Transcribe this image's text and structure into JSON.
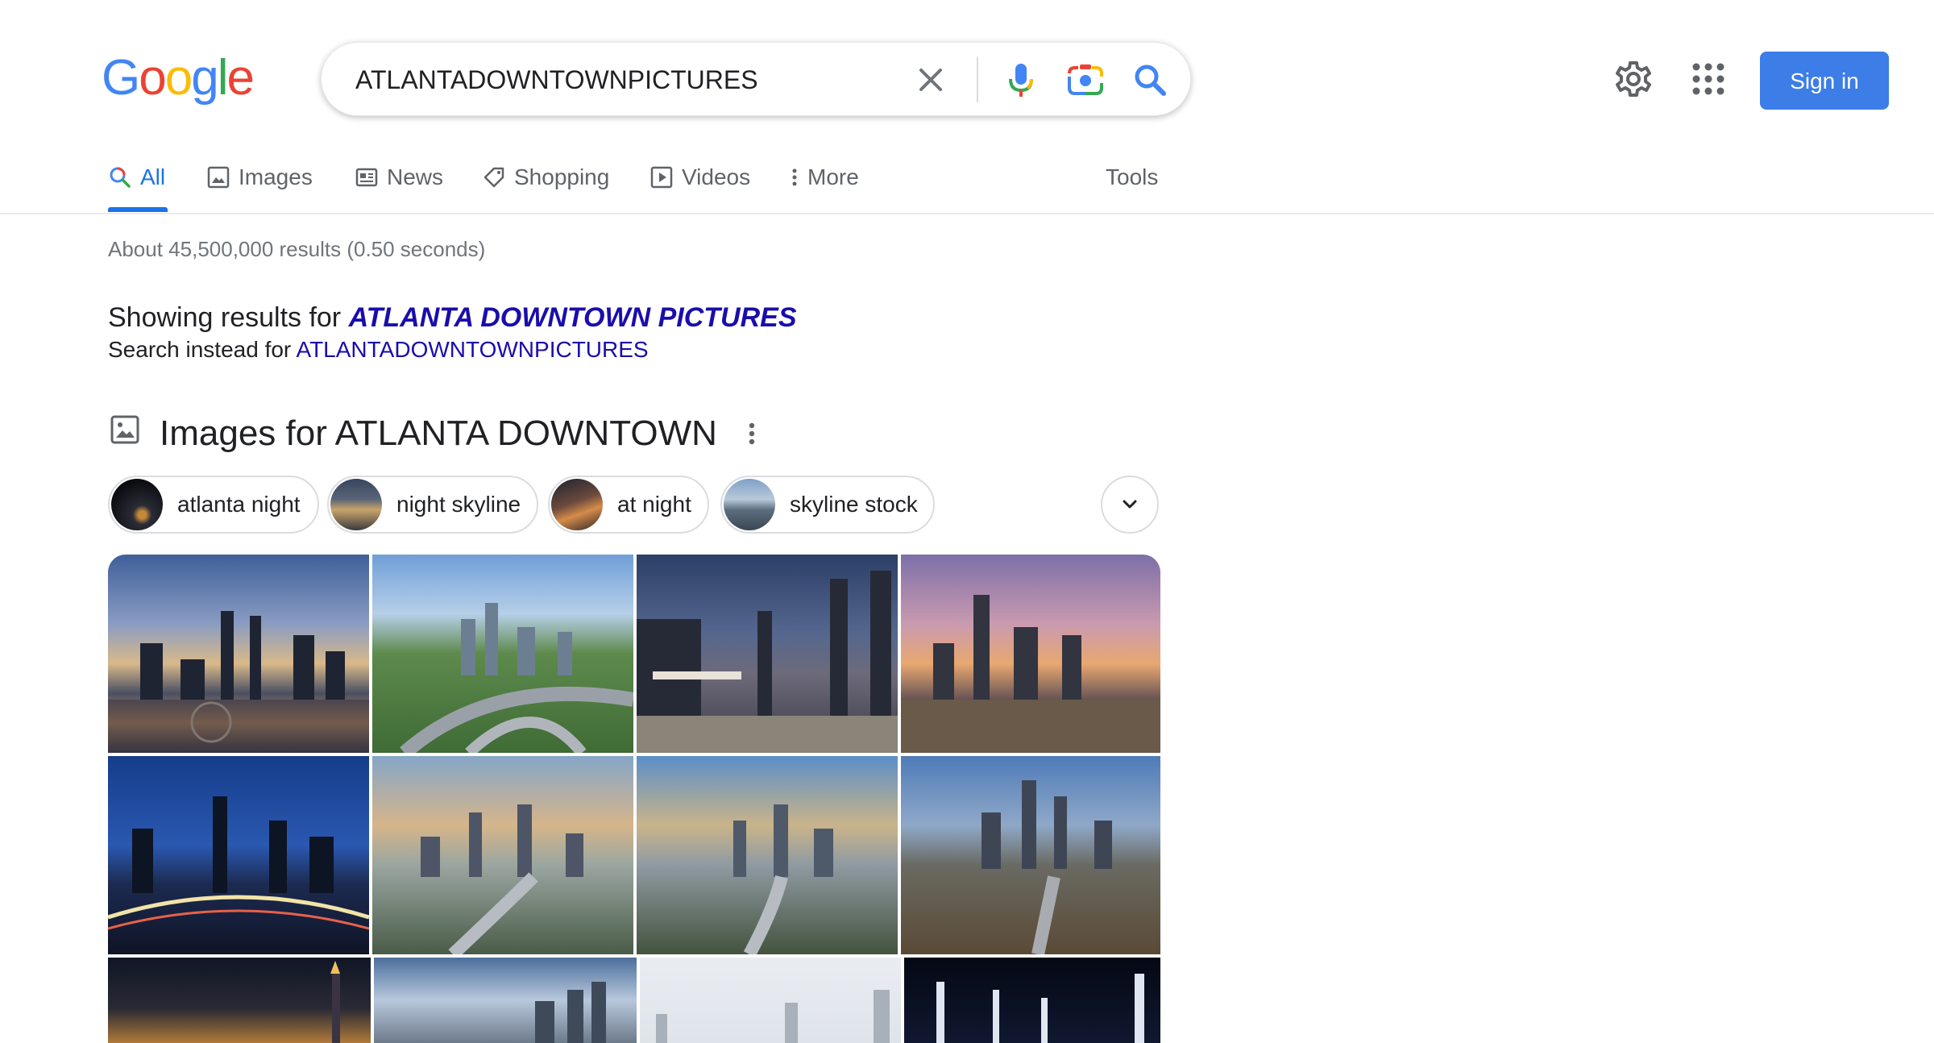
{
  "logo": {
    "text": "Google",
    "letters": [
      "G",
      "o",
      "o",
      "g",
      "l",
      "e"
    ],
    "colors": [
      "#4285f4",
      "#ea4335",
      "#fbbc05",
      "#4285f4",
      "#34a853",
      "#ea4335"
    ]
  },
  "search": {
    "query": "ATLANTADOWNTOWNPICTURES"
  },
  "header": {
    "sign_in_label": "Sign in",
    "settings_icon": "gear-icon",
    "apps_icon": "apps-grid-icon"
  },
  "tabs": [
    {
      "label": "All",
      "icon": "search-icon",
      "active": true
    },
    {
      "label": "Images",
      "icon": "image-icon"
    },
    {
      "label": "News",
      "icon": "news-icon"
    },
    {
      "label": "Shopping",
      "icon": "tag-icon"
    },
    {
      "label": "Videos",
      "icon": "play-icon"
    },
    {
      "label": "More",
      "icon": "kebab-icon"
    }
  ],
  "tools_label": "Tools",
  "result_stats": "About 45,500,000 results (0.50 seconds)",
  "spelling": {
    "showing_prefix": "Showing results for ",
    "corrected_query": "ATLANTA DOWNTOWN PICTURES",
    "instead_prefix": "Search instead for ",
    "original_query": "ATLANTADOWNTOWNPICTURES"
  },
  "images_section": {
    "heading": "Images for ATLANTA DOWNTOWN",
    "chips": [
      {
        "label": "atlanta night"
      },
      {
        "label": "night skyline"
      },
      {
        "label": "at night"
      },
      {
        "label": "skyline stock"
      }
    ]
  },
  "colors": {
    "accent": "#1a73e8",
    "link": "#1a0dab",
    "sign_in_bg": "#3c7de8"
  }
}
